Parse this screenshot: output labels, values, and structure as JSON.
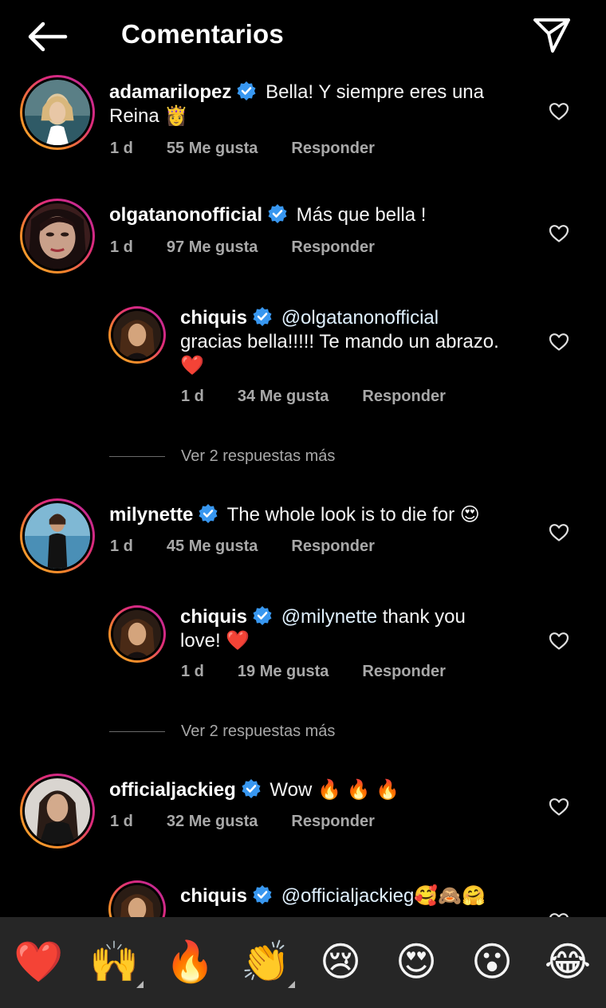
{
  "header": {
    "title": "Comentarios",
    "back_icon": "arrow-left-icon",
    "share_icon": "paper-plane-icon"
  },
  "colors": {
    "verified": "#3897f0",
    "background": "#000000",
    "muted": "#a8a8a8",
    "reaction_bar": "#262626"
  },
  "comments": [
    {
      "username": "adamarilopez",
      "text_1": "Bella! Y siempre eres una",
      "text_2": "Reina",
      "emoji": "👸",
      "time": "1 d",
      "likes": "55 Me gusta",
      "reply": "Responder"
    },
    {
      "username": "olgatanonofficial",
      "text": "Más que bella !",
      "time": "1 d",
      "likes": "97 Me gusta",
      "reply": "Responder"
    },
    {
      "username": "chiquis",
      "mention": "@olgatanonofficial",
      "text_2": "gracias bella!!!!! Te mando un abrazo.",
      "emoji": "❤️",
      "time": "1 d",
      "likes": "34 Me gusta",
      "reply": "Responder"
    },
    {
      "username": "milynette",
      "text": "The whole look is to die for",
      "emoji": "😍",
      "time": "1 d",
      "likes": "45 Me gusta",
      "reply": "Responder"
    },
    {
      "username": "chiquis",
      "mention": "@milynette",
      "text_1": "thank you",
      "text_2": "love!",
      "emoji": "❤️",
      "time": "1 d",
      "likes": "19 Me gusta",
      "reply": "Responder"
    },
    {
      "username": "officialjackieg",
      "text": "Wow",
      "emoji": "🔥 🔥 🔥",
      "time": "1 d",
      "likes": "32 Me gusta",
      "reply": "Responder"
    },
    {
      "username": "chiquis",
      "mention": "@officialjackieg",
      "emoji": "🥰🙈🤗"
    }
  ],
  "more_replies": [
    "Ver 2 respuestas más",
    "Ver 2 respuestas más"
  ],
  "reactions": [
    "❤️",
    "🙌",
    "🔥",
    "👏",
    "😢",
    "😍",
    "😮",
    "😂"
  ]
}
